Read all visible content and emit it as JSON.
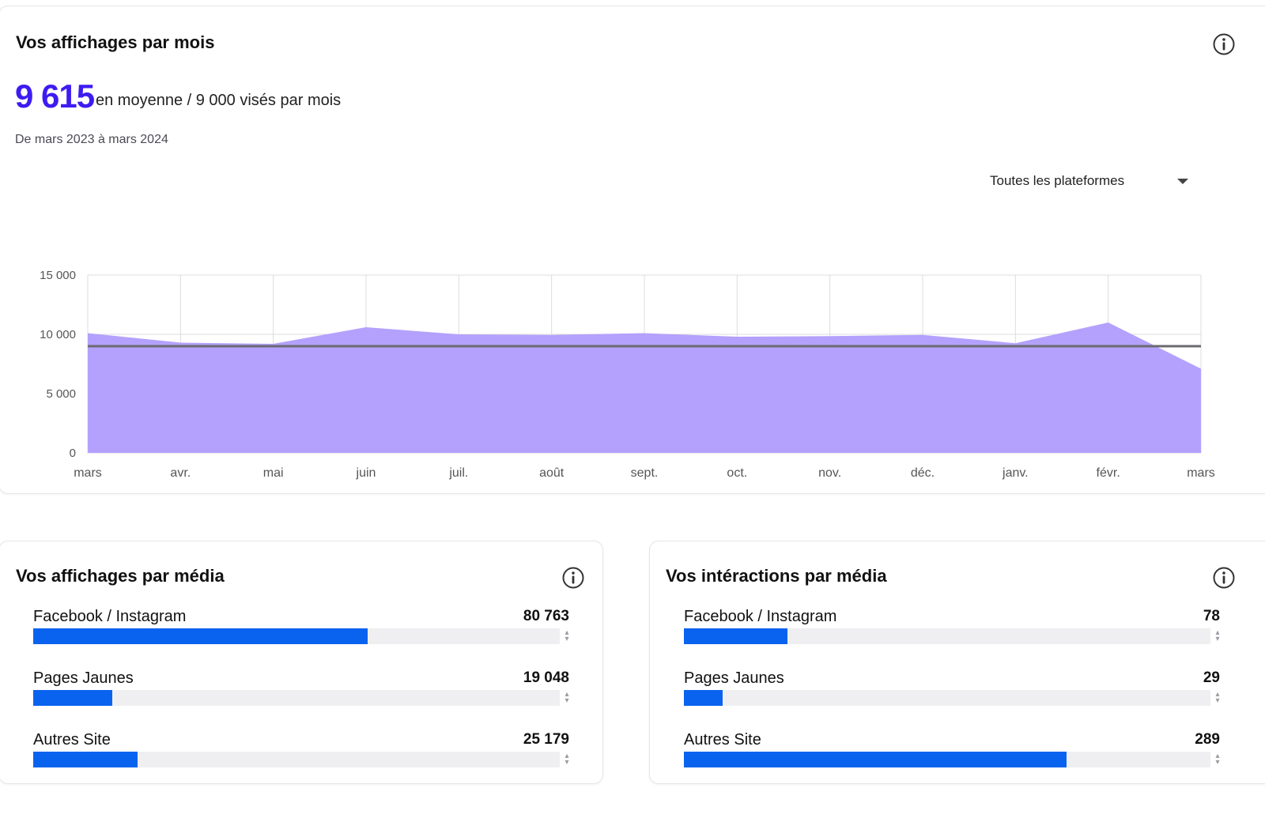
{
  "views": {
    "title": "Vos affichages par mois",
    "average_value": "9 615",
    "average_text": "en moyenne / 9 000 visés par mois",
    "period": "De mars 2023 à mars 2024",
    "platform_select": {
      "value": "Toutes les plateformes"
    }
  },
  "chart_data": {
    "type": "area",
    "x": [
      "mars",
      "avr.",
      "mai",
      "juin",
      "juil.",
      "août",
      "sept.",
      "oct.",
      "nov.",
      "déc.",
      "janv.",
      "févr.",
      "mars"
    ],
    "series": [
      {
        "values": [
          10100,
          9300,
          9200,
          10600,
          10000,
          9950,
          10100,
          9800,
          9850,
          9950,
          9250,
          11000,
          7100
        ]
      }
    ],
    "target_line": 9000,
    "ylim": [
      0,
      15000
    ],
    "yticks": [
      "0",
      "5 000",
      "10 000",
      "15 000"
    ],
    "grid": true,
    "colors": {
      "area": "#b4a1fd",
      "target": "#6b6b70",
      "grid": "#dcdcdf"
    }
  },
  "views_by_media": {
    "title": "Vos affichages par média",
    "items": [
      {
        "label": "Facebook / Instagram",
        "value": "80 763",
        "fraction": 0.635
      },
      {
        "label": "Pages Jaunes",
        "value": "19 048",
        "fraction": 0.15
      },
      {
        "label": "Autres Site",
        "value": "25 179",
        "fraction": 0.198
      }
    ]
  },
  "interactions_by_media": {
    "title": "Vos intéractions par média",
    "items": [
      {
        "label": "Facebook / Instagram",
        "value": "78",
        "fraction": 0.196
      },
      {
        "label": "Pages Jaunes",
        "value": "29",
        "fraction": 0.073
      },
      {
        "label": "Autres Site",
        "value": "289",
        "fraction": 0.726
      }
    ]
  },
  "icons": {
    "info": "info-icon",
    "dropdown": "caret-down-icon",
    "spinner": "sort-arrows-icon"
  },
  "colors": {
    "accent": "#3d1cf2",
    "bar": "#0a63ef",
    "track": "#efeff1"
  }
}
